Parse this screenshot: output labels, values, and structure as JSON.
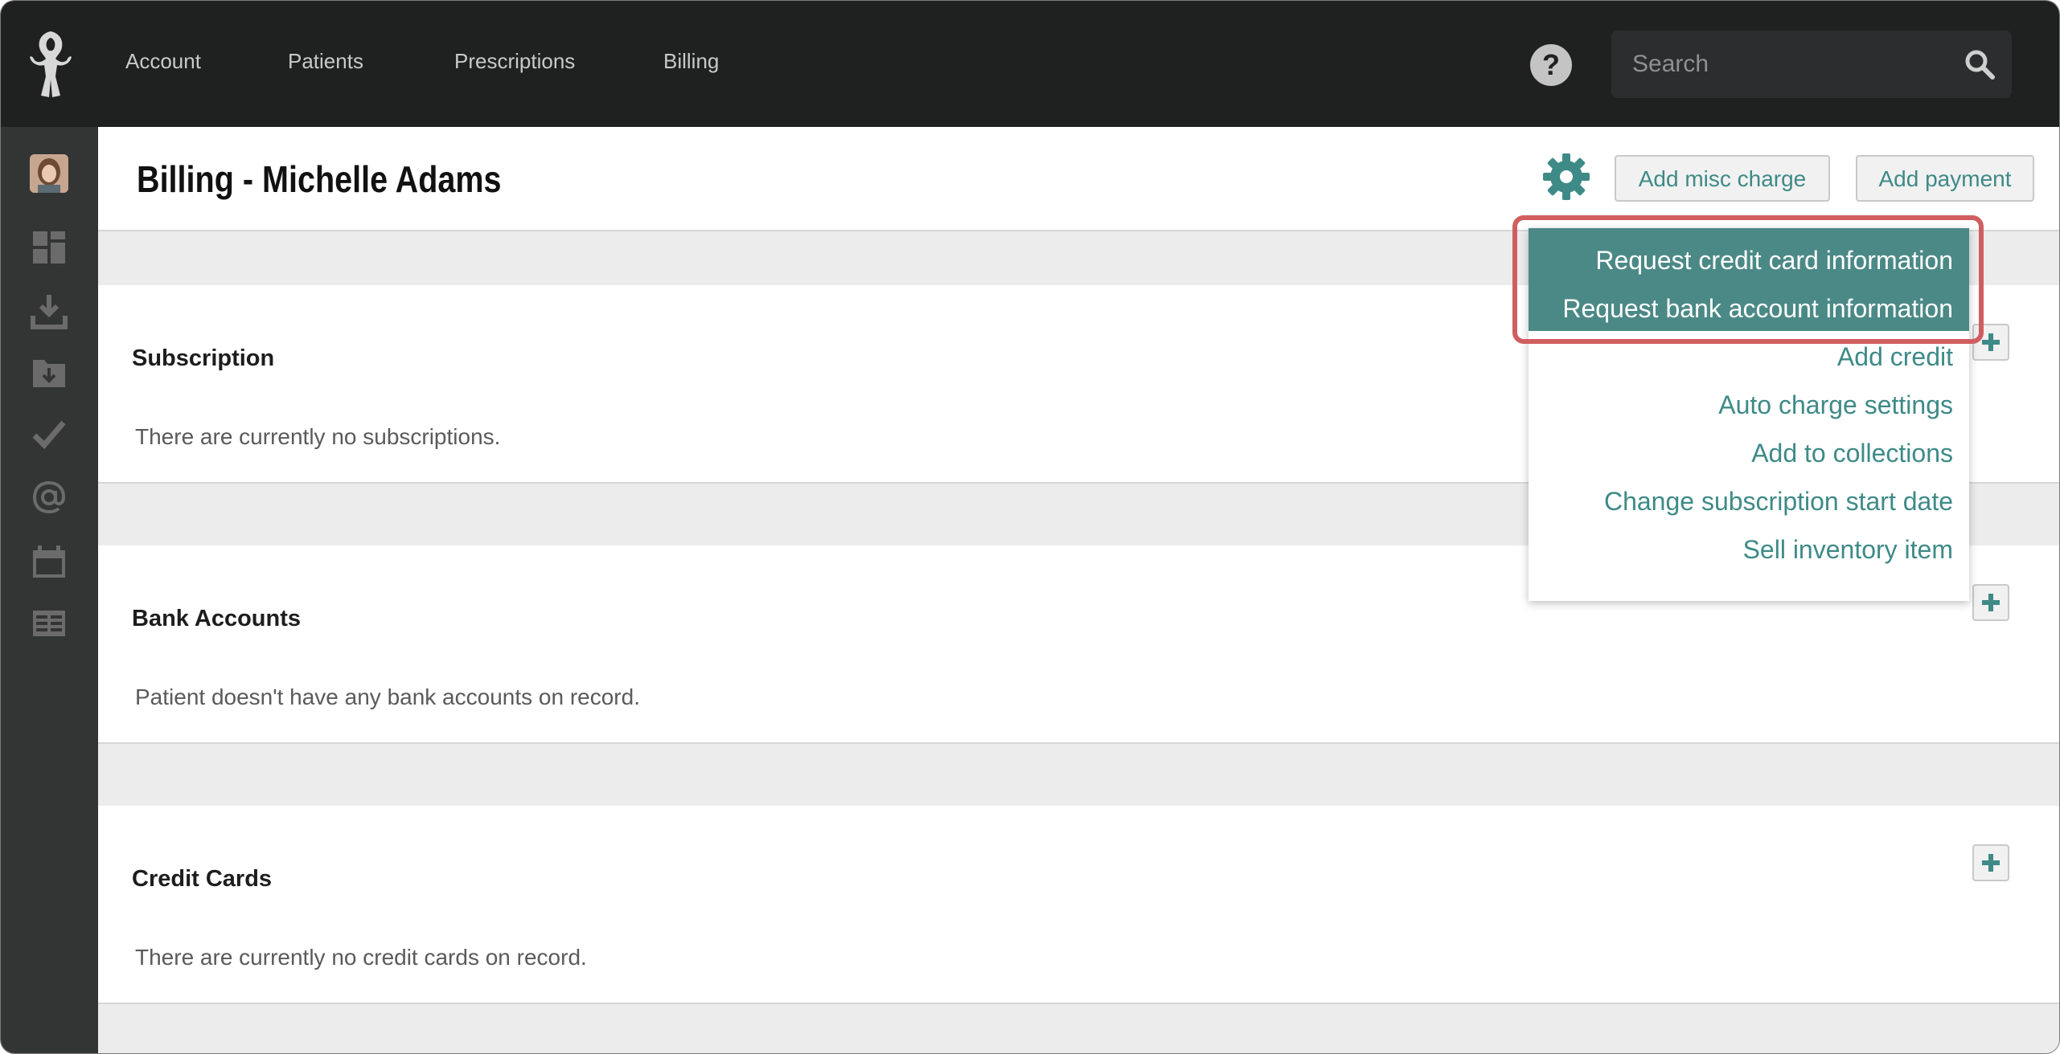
{
  "nav": {
    "items": [
      "Account",
      "Patients",
      "Prescriptions",
      "Billing"
    ],
    "search_placeholder": "Search",
    "help_label": "?"
  },
  "sidebar": {
    "icons": [
      "avatar",
      "dashboard-icon",
      "download-icon",
      "folder-download-icon",
      "checkmark-icon",
      "at-sign-icon",
      "calendar-icon",
      "records-icon"
    ]
  },
  "header": {
    "title": "Billing - Michelle Adams",
    "add_misc_charge": "Add misc charge",
    "add_payment": "Add payment"
  },
  "sections": [
    {
      "title": "Subscription",
      "text": "There are currently no subscriptions."
    },
    {
      "title": "Bank Accounts",
      "text": "Patient doesn't have any bank accounts on record."
    },
    {
      "title": "Credit Cards",
      "text": "There are currently no credit cards on record."
    }
  ],
  "dropdown": {
    "items": [
      "Request credit card information",
      "Request bank account information",
      "Add credit",
      "Auto charge settings",
      "Add to collections",
      "Change subscription start date",
      "Sell inventory item"
    ]
  },
  "colors": {
    "accent": "#3e8a87",
    "highlight": "#4b8986",
    "topbar": "#1f2121",
    "sidebar": "#333434",
    "callout": "#d05e60"
  }
}
